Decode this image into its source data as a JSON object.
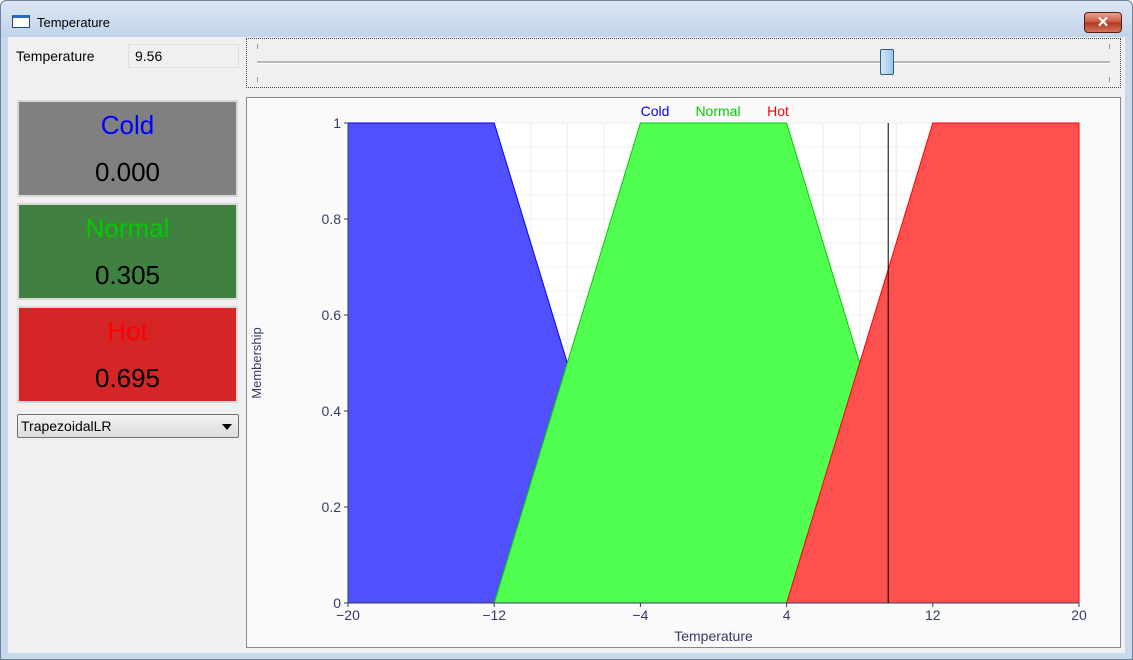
{
  "window": {
    "title": "Temperature",
    "close_symbol": "✕"
  },
  "input": {
    "label": "Temperature",
    "value": "9.56"
  },
  "slider": {
    "min": -20,
    "max": 20,
    "value": 9.56
  },
  "panels": [
    {
      "name": "Cold",
      "value": "0.000",
      "bg": "#808080",
      "name_color": "#0000ff"
    },
    {
      "name": "Normal",
      "value": "0.305",
      "bg": "#408040",
      "name_color": "#00cc00"
    },
    {
      "name": "Hot",
      "value": "0.695",
      "bg": "#d42626",
      "name_color": "#ff0000"
    }
  ],
  "dropdown": {
    "selected": "TrapezoidalLR"
  },
  "chart_data": {
    "type": "area",
    "xlabel": "Temperature",
    "ylabel": "Membership",
    "xlim": [
      -20,
      20
    ],
    "ylim": [
      0,
      1
    ],
    "x_ticks": [
      -20,
      -12,
      -4,
      4,
      12,
      20
    ],
    "y_ticks": [
      0,
      0.2,
      0.4,
      0.6,
      0.8,
      1
    ],
    "x_tick_labels": [
      "−20",
      "−12",
      "−4",
      "4",
      "12",
      "20"
    ],
    "y_tick_labels": [
      "0",
      "0.2",
      "0.4",
      "0.6",
      "0.8",
      "1"
    ],
    "legend_position": "top-center",
    "cursor_x": 9.56,
    "series": [
      {
        "name": "Cold",
        "color": "#0000ff",
        "fill": "#5050ff",
        "points": [
          [
            -20,
            0
          ],
          [
            -20,
            1
          ],
          [
            -12,
            1
          ],
          [
            -4,
            0
          ]
        ]
      },
      {
        "name": "Normal",
        "color": "#00cc00",
        "fill": "#50ff50",
        "points": [
          [
            -12,
            0
          ],
          [
            -4,
            1
          ],
          [
            4,
            1
          ],
          [
            12,
            0
          ]
        ]
      },
      {
        "name": "Hot",
        "color": "#ff0000",
        "fill": "#ff5050",
        "points": [
          [
            4,
            0
          ],
          [
            12,
            1
          ],
          [
            20,
            1
          ],
          [
            20,
            0
          ]
        ]
      }
    ]
  }
}
